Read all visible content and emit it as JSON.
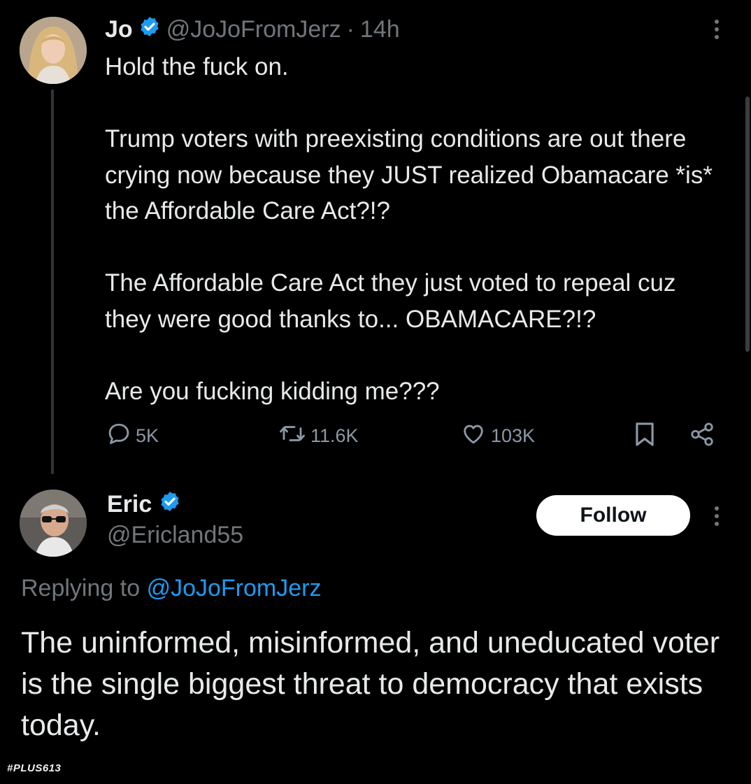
{
  "tweet": {
    "author_name": "Jo",
    "handle": "@JoJoFromJerz",
    "separator": "·",
    "time": "14h",
    "paragraphs": [
      "Hold the fuck on.",
      "Trump voters with preexisting conditions are out there crying now because they JUST realized Obamacare *is* the Affordable Care Act?!?",
      "The Affordable Care Act they just voted to repeal cuz they were good thanks to... OBAMACARE?!?",
      "Are you fucking kidding me???"
    ],
    "replies": "5K",
    "reposts": "11.6K",
    "likes": "103K",
    "icons": [
      "reply-icon",
      "repost-icon",
      "like-icon",
      "bookmark-icon",
      "share-icon",
      "more-icon"
    ]
  },
  "reply": {
    "author_name": "Eric",
    "handle": "@Ericland55",
    "follow_label": "Follow",
    "replying_to_prefix": "Replying to",
    "replying_to_handle": "@JoJoFromJerz",
    "text": "The uninformed, misinformed, and uneducated voter is the single biggest threat to democracy that exists today."
  },
  "watermark": "#PLUS613",
  "colors": {
    "background": "#000000",
    "text": "#e7e9ea",
    "muted": "#71767b",
    "accent": "#1d9bf0",
    "follow_bg": "#ffffff"
  }
}
